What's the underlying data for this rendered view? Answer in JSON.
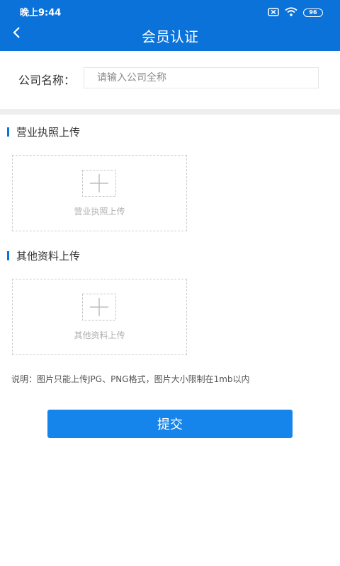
{
  "status_bar": {
    "time": "晚上9:44",
    "battery": "96"
  },
  "nav": {
    "title": "会员认证"
  },
  "company": {
    "label": "公司名称：",
    "placeholder": "请输入公司全称",
    "value": ""
  },
  "sections": [
    {
      "title": "营业执照上传",
      "upload_hint": "营业执照上传"
    },
    {
      "title": "其他资料上传",
      "upload_hint": "其他资料上传"
    }
  ],
  "note": "说明：图片只能上传JPG、PNG格式，图片大小限制在1mb以内",
  "submit_label": "提交",
  "icons": {
    "back": "chevron-left-icon",
    "close_box": "close-box-icon",
    "wifi": "wifi-icon",
    "battery": "battery-icon",
    "upload": "plus-icon"
  },
  "colors": {
    "primary": "#0b72d9",
    "button": "#1585ec",
    "divider": "#eeeeee",
    "placeholder": "#b0b0b0"
  }
}
